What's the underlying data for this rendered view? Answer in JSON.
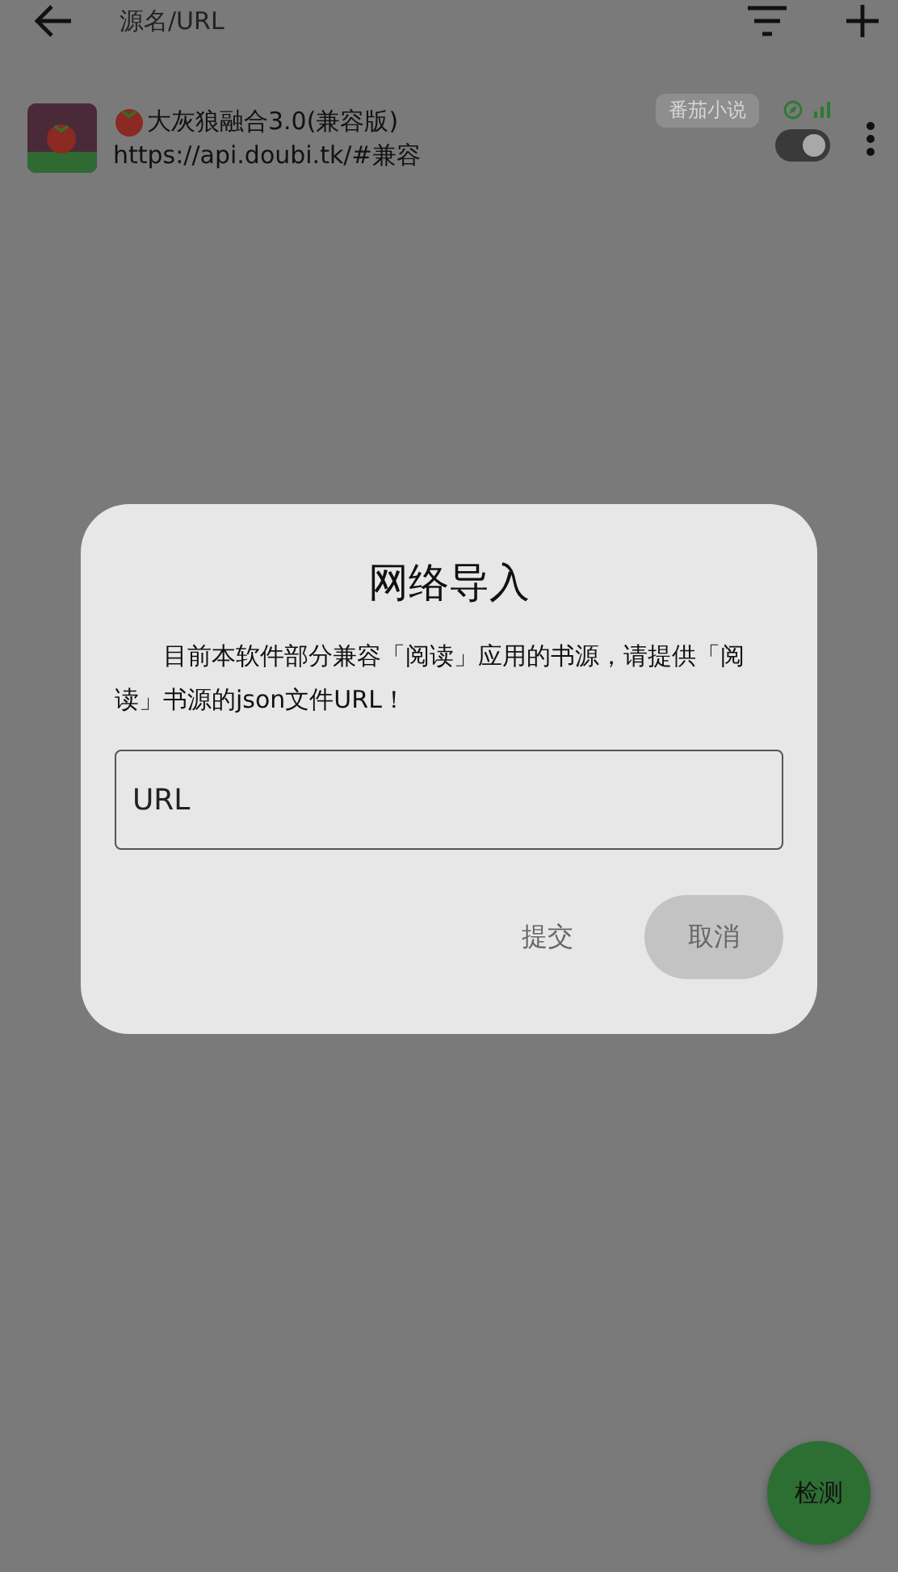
{
  "toolbar": {
    "search": {
      "placeholder": "源名/URL"
    }
  },
  "sources": [
    {
      "name": "大灰狼融合3.0(兼容版)",
      "url": "https://api.doubi.tk/#兼容",
      "tag": "番茄小说",
      "enabled": true
    }
  ],
  "dialog": {
    "title": "网络导入",
    "message": "目前本软件部分兼容「阅读」应用的书源，请提供「阅读」书源的json文件URL！",
    "field": {
      "placeholder": "URL"
    },
    "buttons": [
      {
        "label": "提交",
        "kind": "text"
      },
      {
        "label": "取消",
        "kind": "tonal"
      }
    ]
  },
  "fab": {
    "label": "检测"
  }
}
